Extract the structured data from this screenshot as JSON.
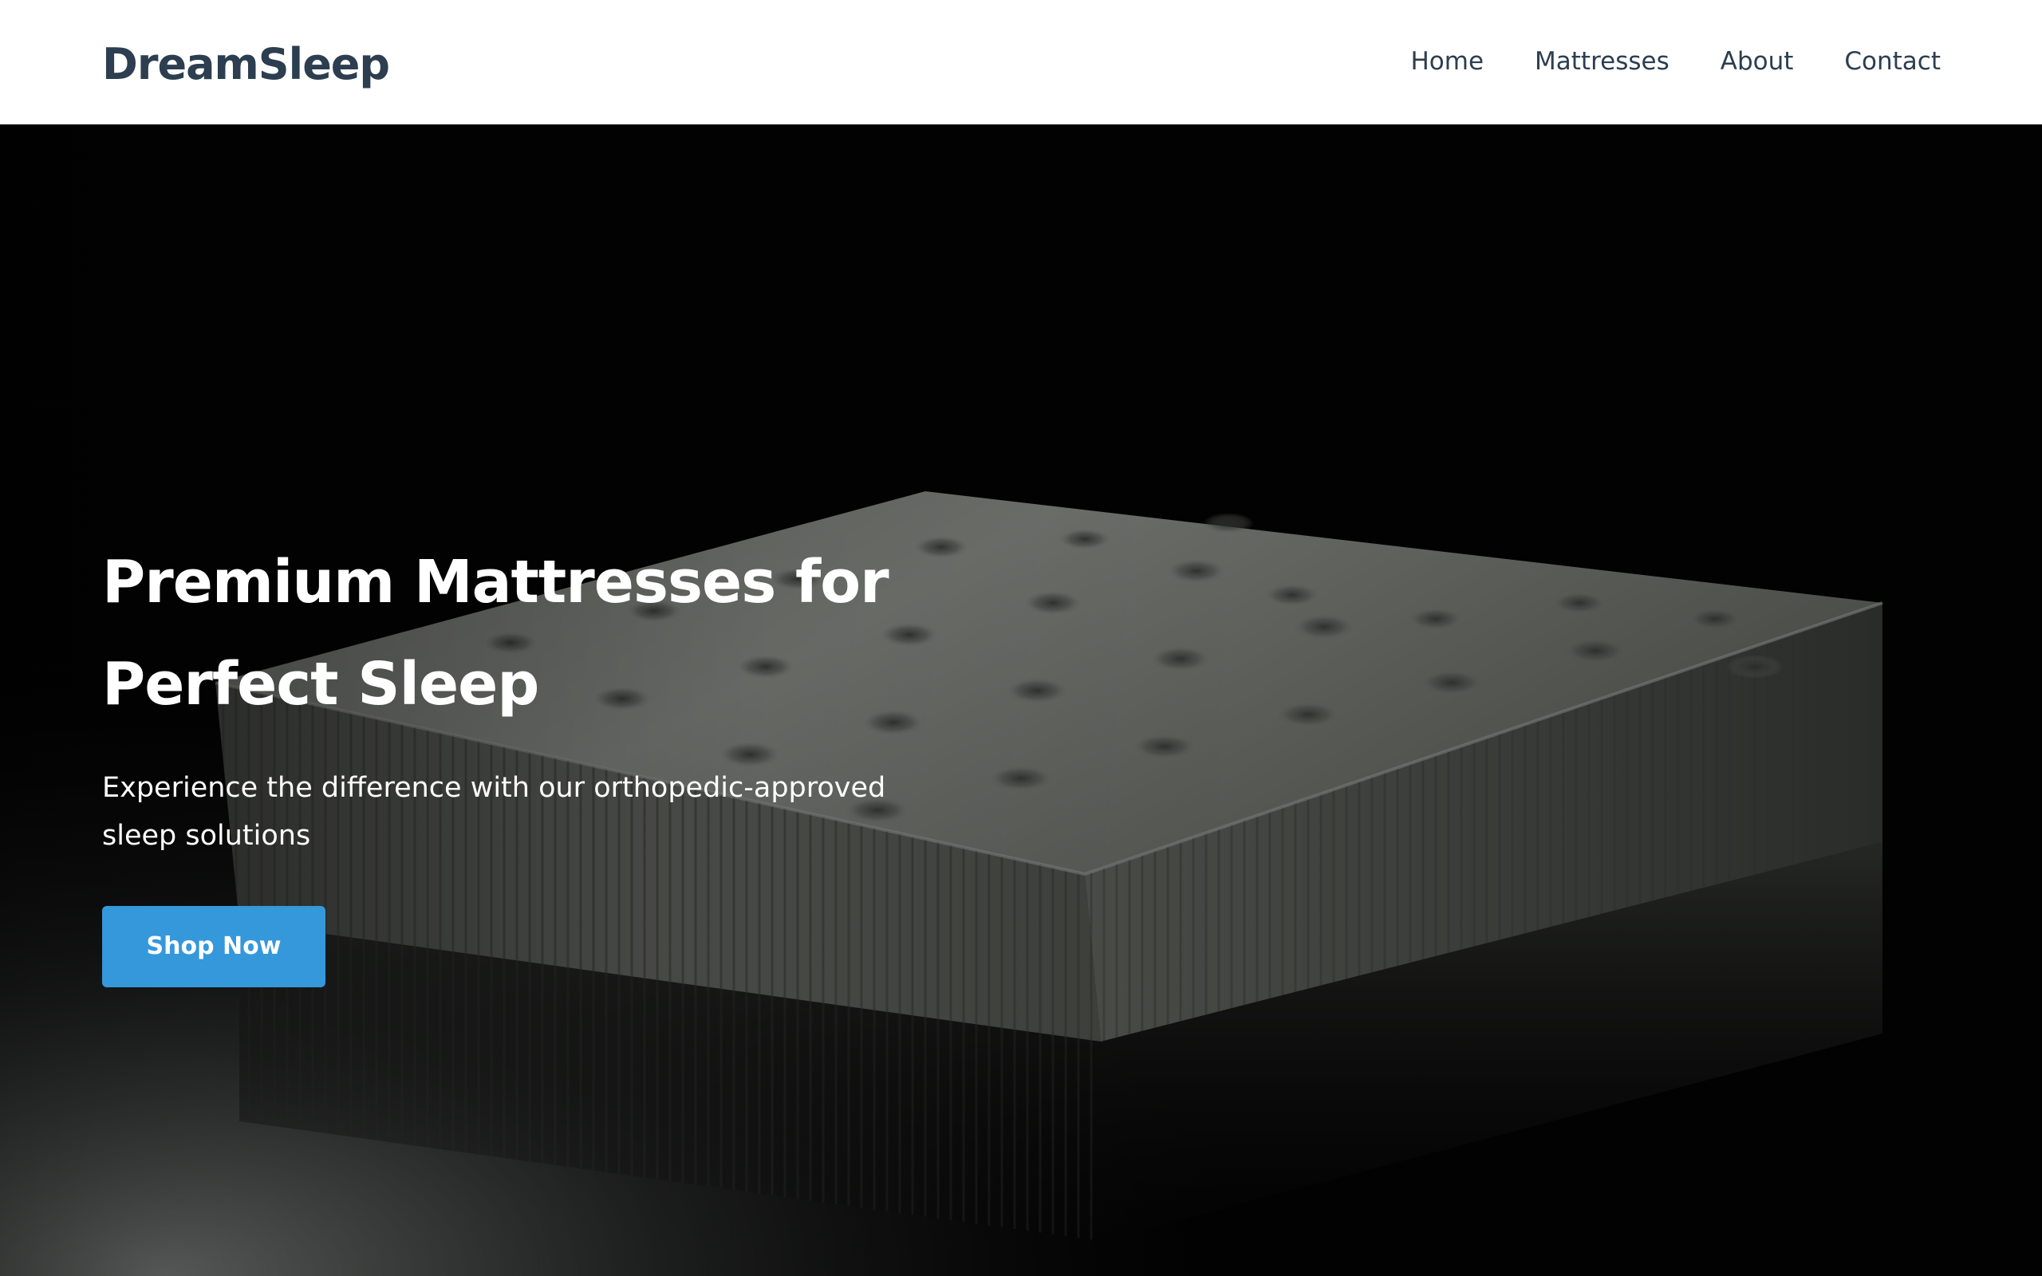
{
  "header": {
    "logo": "DreamSleep",
    "nav": [
      "Home",
      "Mattresses",
      "About",
      "Contact"
    ]
  },
  "hero": {
    "title": "Premium Mattresses for Perfect Sleep",
    "subtitle": "Experience the difference with our orthopedic-approved sleep solutions",
    "cta_label": "Shop Now",
    "image_subject": "tufted mattress on dark reflective floor"
  },
  "colors": {
    "brand_text": "#2c3e50",
    "accent": "#3498db",
    "header_bg": "#ffffff",
    "hero_bg": "#020202",
    "hero_text": "#ffffff"
  }
}
